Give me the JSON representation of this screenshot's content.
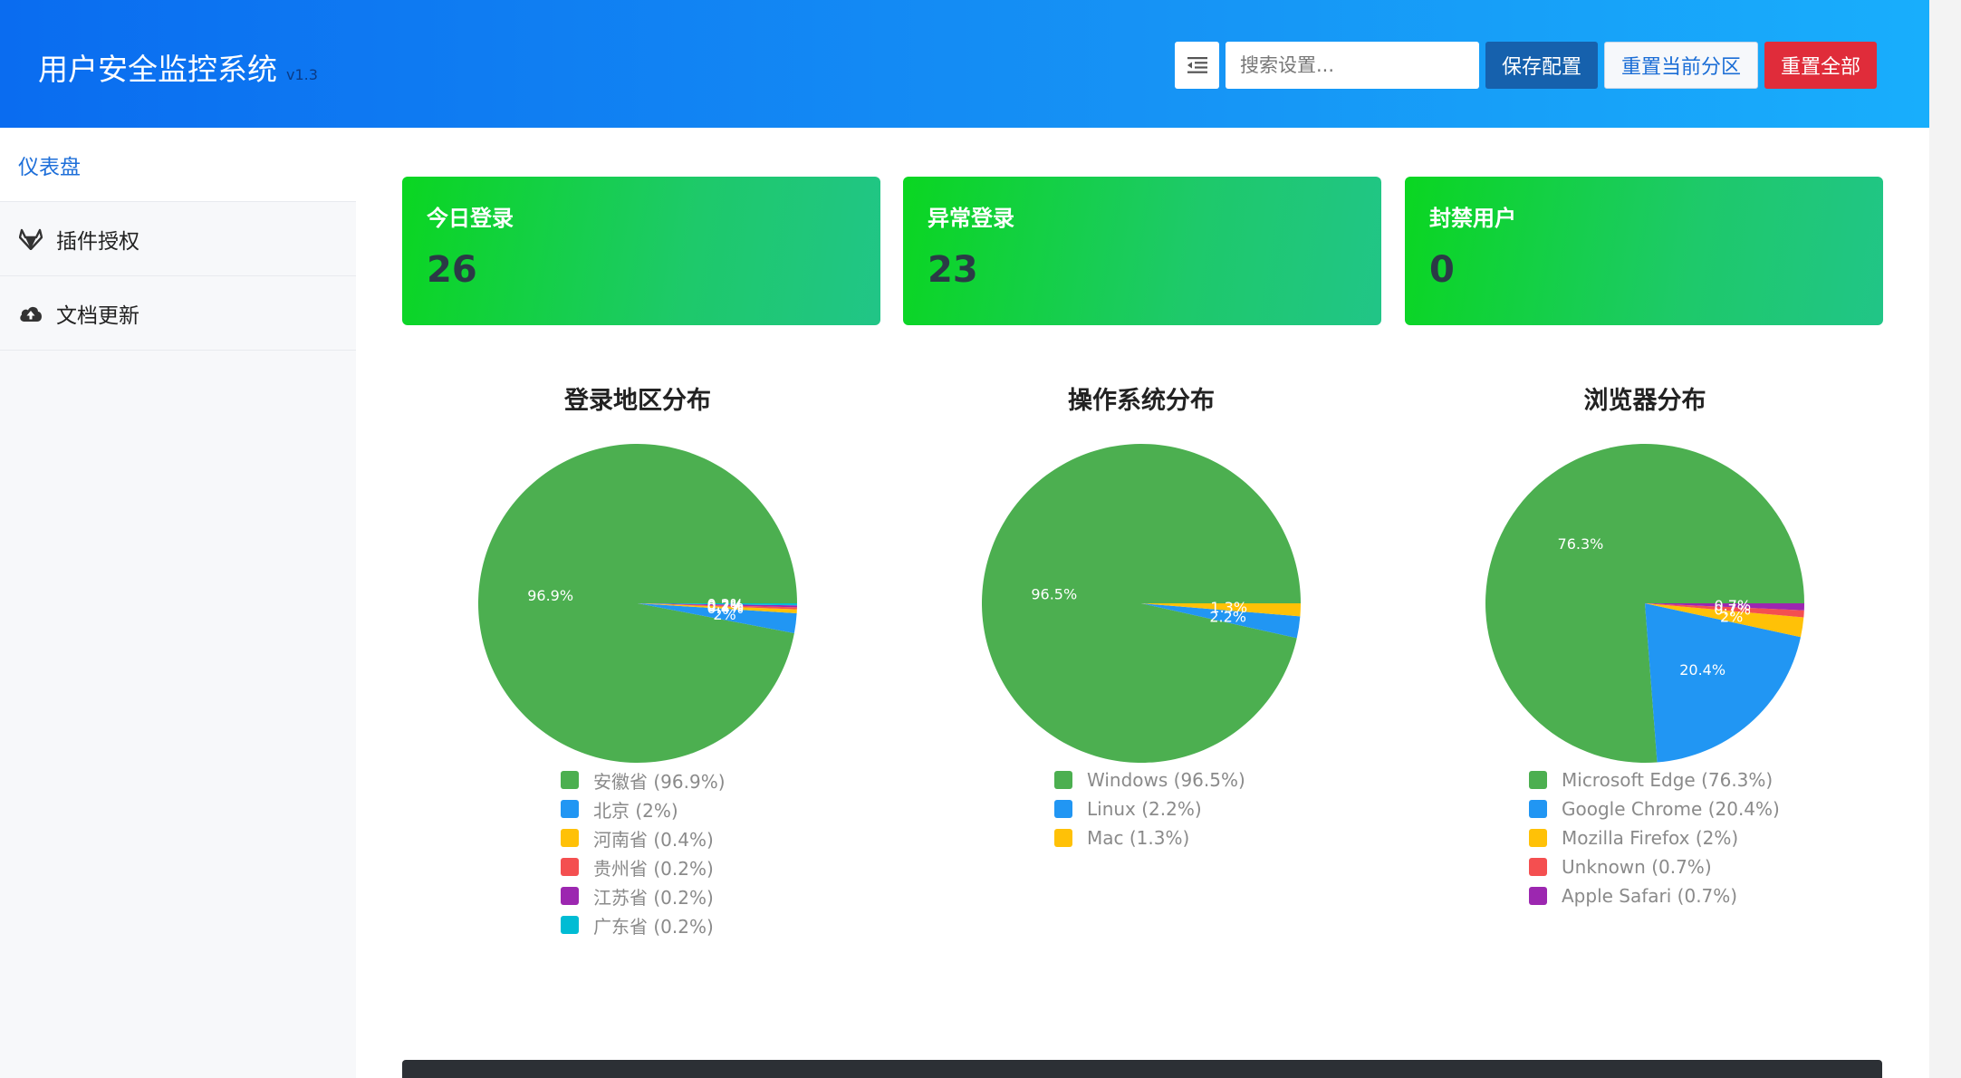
{
  "app": {
    "title": "用户安全监控系统",
    "version": "v1.3"
  },
  "toolbar": {
    "search_placeholder": "搜索设置...",
    "save_label": "保存配置",
    "reset_section_label": "重置当前分区",
    "reset_all_label": "重置全部"
  },
  "sidebar": {
    "items": [
      {
        "label": "仪表盘",
        "icon": "dashboard",
        "active": true
      },
      {
        "label": "插件授权",
        "icon": "gitlab-fox-icon"
      },
      {
        "label": "文档更新",
        "icon": "cloud-upload-icon"
      }
    ]
  },
  "stats": [
    {
      "label": "今日登录",
      "value": "26"
    },
    {
      "label": "异常登录",
      "value": "23"
    },
    {
      "label": "封禁用户",
      "value": "0"
    }
  ],
  "chart_data": [
    {
      "type": "pie",
      "title": "登录地区分布",
      "series": [
        {
          "name": "安徽省",
          "value": 96.9,
          "color": "#4caf50",
          "label": "96.9%",
          "legend": "安徽省 (96.9%)"
        },
        {
          "name": "北京",
          "value": 2,
          "color": "#2196f3",
          "label": "2%",
          "legend": "北京 (2%)"
        },
        {
          "name": "河南省",
          "value": 0.4,
          "color": "#ffc107",
          "label": "0.4%",
          "legend": "河南省 (0.4%)"
        },
        {
          "name": "贵州省",
          "value": 0.2,
          "color": "#f44f50",
          "label": "0.2%",
          "legend": "贵州省 (0.2%)"
        },
        {
          "name": "江苏省",
          "value": 0.2,
          "color": "#9c27b0",
          "label": "0.2%",
          "legend": "江苏省 (0.2%)"
        },
        {
          "name": "广东省",
          "value": 0.2,
          "color": "#00bcd4",
          "label": "0.2%",
          "legend": "广东省 (0.2%)"
        }
      ]
    },
    {
      "type": "pie",
      "title": "操作系统分布",
      "series": [
        {
          "name": "Windows",
          "value": 96.5,
          "color": "#4caf50",
          "label": "96.5%",
          "legend": "Windows (96.5%)"
        },
        {
          "name": "Linux",
          "value": 2.2,
          "color": "#2196f3",
          "label": "2.2%",
          "legend": "Linux (2.2%)"
        },
        {
          "name": "Mac",
          "value": 1.3,
          "color": "#ffc107",
          "label": "1.3%",
          "legend": "Mac (1.3%)"
        }
      ]
    },
    {
      "type": "pie",
      "title": "浏览器分布",
      "series": [
        {
          "name": "Microsoft Edge",
          "value": 76.3,
          "color": "#4caf50",
          "label": "76.3%",
          "legend": "Microsoft Edge (76.3%)"
        },
        {
          "name": "Google Chrome",
          "value": 20.4,
          "color": "#2196f3",
          "label": "20.4%",
          "legend": "Google Chrome (20.4%)"
        },
        {
          "name": "Mozilla Firefox",
          "value": 2,
          "color": "#ffc107",
          "label": "2%",
          "legend": "Mozilla Firefox (2%)"
        },
        {
          "name": "Unknown",
          "value": 0.7,
          "color": "#f44f50",
          "label": "0.7%",
          "legend": "Unknown (0.7%)"
        },
        {
          "name": "Apple Safari",
          "value": 0.7,
          "color": "#9c27b0",
          "label": "0.7%",
          "legend": "Apple Safari (0.7%)"
        }
      ]
    }
  ]
}
